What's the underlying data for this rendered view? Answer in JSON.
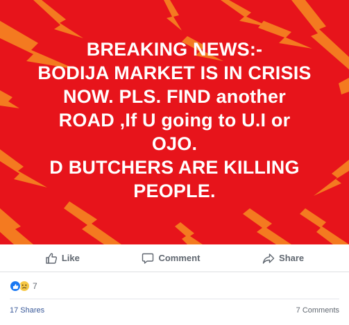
{
  "banner": {
    "lines": [
      "BREAKING NEWS:-",
      "BODIJA MARKET IS IN CRISIS",
      "NOW. PLS. FIND another",
      "ROAD ,If U going to U.I or",
      "OJO.",
      "D BUTCHERS ARE KILLING",
      "PEOPLE."
    ],
    "background_color": "#e7141b",
    "bolt_color": "#f47a20",
    "text_color": "#ffffff"
  },
  "actions": {
    "like_label": "Like",
    "comment_label": "Comment",
    "share_label": "Share"
  },
  "reactions": {
    "icons": [
      "like-icon",
      "sad-icon"
    ],
    "count": "7"
  },
  "footer": {
    "shares": "17 Shares",
    "comments": "7 Comments"
  }
}
